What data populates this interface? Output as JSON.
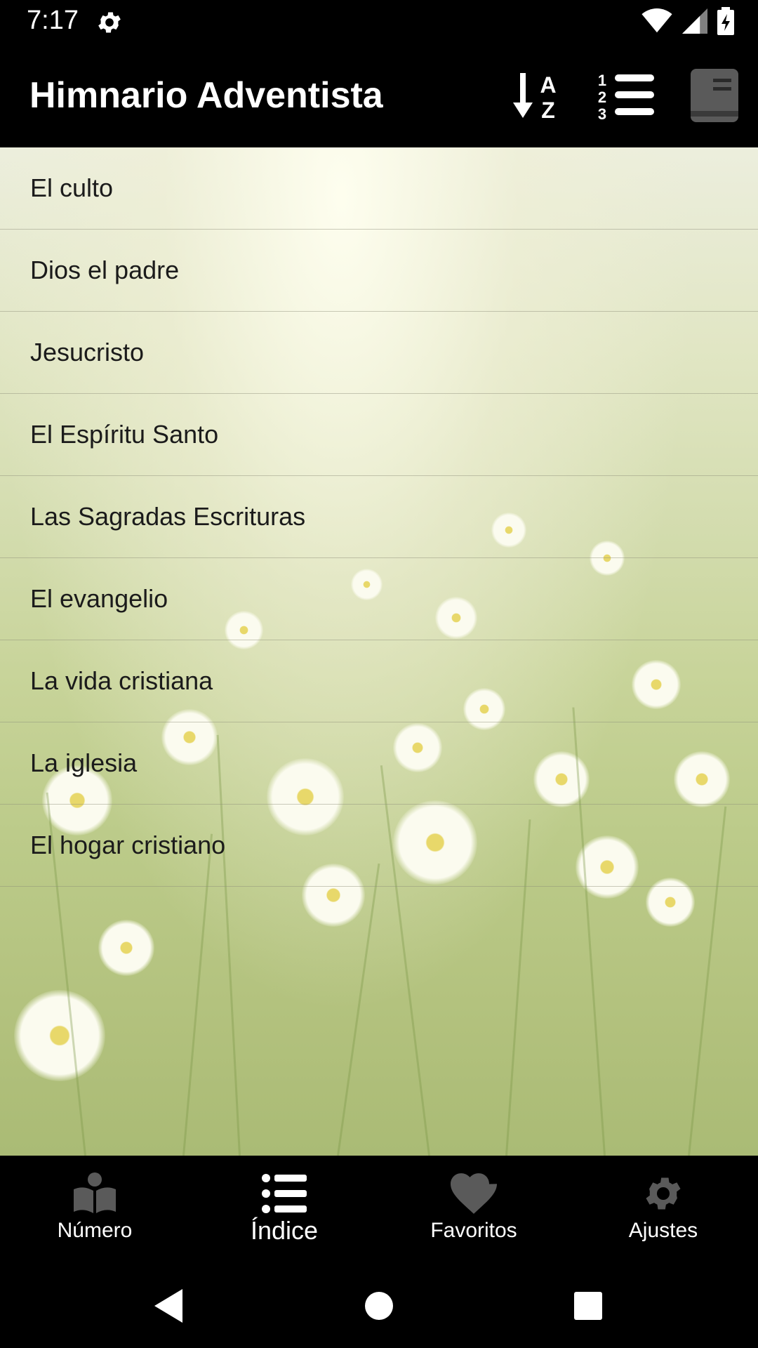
{
  "status_bar": {
    "time": "7:17",
    "icons": [
      "settings-icon",
      "wifi-icon",
      "signal-icon",
      "battery-icon"
    ]
  },
  "app_bar": {
    "title": "Himnario Adventista",
    "actions": [
      "sort-alphabetical-icon",
      "sort-numeric-icon",
      "book-icon"
    ]
  },
  "topics": [
    "El culto",
    "Dios el padre",
    "Jesucristo",
    "El Espíritu Santo",
    "Las Sagradas Escrituras",
    "El evangelio",
    "La vida cristiana",
    "La iglesia",
    "El hogar cristiano"
  ],
  "bottom_nav": {
    "items": [
      {
        "label": "Número",
        "icon": "open-book-icon"
      },
      {
        "label": "Índice",
        "icon": "list-icon",
        "active": true
      },
      {
        "label": "Favoritos",
        "icon": "heart-icon"
      },
      {
        "label": "Ajustes",
        "icon": "gear-icon"
      }
    ]
  },
  "colors": {
    "bars": "#000000",
    "text_light": "#ffffff",
    "text_dark": "#1b1b1b",
    "nav_icon_inactive": "#5a5a5a",
    "nav_icon_active": "#ffffff"
  }
}
